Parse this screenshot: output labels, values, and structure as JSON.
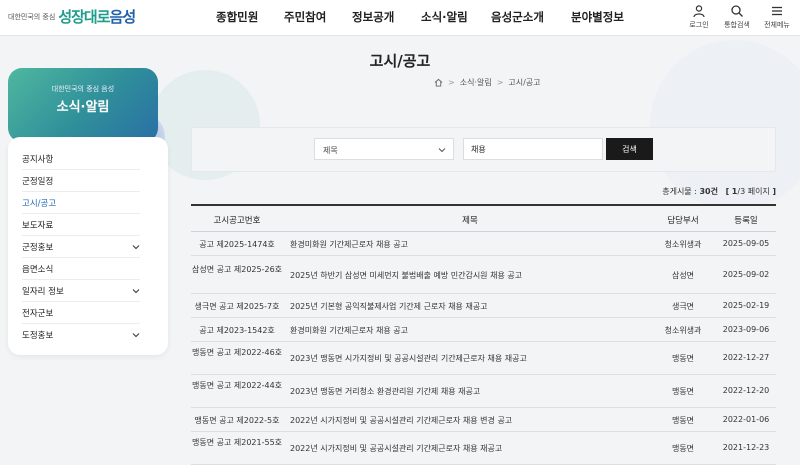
{
  "header": {
    "logo_small": "대한민국의 중심",
    "logo_main_a": "성장대로",
    "logo_main_b": "음성",
    "nav": [
      "종합민원",
      "주민참여",
      "정보공개",
      "소식·알림",
      "음성군소개",
      "분야별정보"
    ],
    "utils": [
      {
        "label": "로그인",
        "icon": "user-icon"
      },
      {
        "label": "통합검색",
        "icon": "search-icon"
      },
      {
        "label": "전체메뉴",
        "icon": "menu-icon"
      }
    ]
  },
  "page": {
    "title": "고시/공고",
    "breadcrumb": [
      "소식·알림",
      "고시/공고"
    ]
  },
  "side": {
    "sub": "대한민국의 중심 음성",
    "title": "소식·알림",
    "items": [
      {
        "label": "공지사항",
        "has_children": false,
        "active": false
      },
      {
        "label": "군정일정",
        "has_children": false,
        "active": false
      },
      {
        "label": "고시/공고",
        "has_children": false,
        "active": true
      },
      {
        "label": "보도자료",
        "has_children": false,
        "active": false
      },
      {
        "label": "군정홍보",
        "has_children": true,
        "active": false
      },
      {
        "label": "읍면소식",
        "has_children": false,
        "active": false
      },
      {
        "label": "일자리 정보",
        "has_children": true,
        "active": false
      },
      {
        "label": "전자군보",
        "has_children": false,
        "active": false
      },
      {
        "label": "도정홍보",
        "has_children": true,
        "active": false
      }
    ]
  },
  "search": {
    "field_selected": "제목",
    "query": "채용",
    "button": "검색"
  },
  "summary": {
    "total_label": "총게시물 : ",
    "total_count": "30건",
    "page_open": "[",
    "page_current": "1",
    "page_rest": "/3 페이지",
    "page_close": "]"
  },
  "table": {
    "headers": [
      "고시공고번호",
      "제목",
      "담당부서",
      "등록일"
    ],
    "rows": [
      {
        "num": "공고 제2025-1474호",
        "title": "환경미화원 기간제근로자 채용 공고",
        "dept": "청소위생과",
        "date": "2025-09-05"
      },
      {
        "num": "삼성면 공고 제2025-26호",
        "title": "2025년 하반기 삼성면 미세먼지 불법배출 예방 민간감시원 채용 공고",
        "dept": "삼성면",
        "date": "2025-09-02"
      },
      {
        "num": "생극면 공고 제2025-7호",
        "title": "2025년 기본형 공익직불제사업 기간제 근로자 채용 재공고",
        "dept": "생극면",
        "date": "2025-02-19"
      },
      {
        "num": "공고 제2023-1542호",
        "title": "환경미화원 기간제근로자 채용 공고",
        "dept": "청소위생과",
        "date": "2023-09-06"
      },
      {
        "num": "맹동면 공고 제2022-46호",
        "title": "2023년 맹동면 시가지정비 및 공공시설관리 기간제근로자 채용 재공고",
        "dept": "맹동면",
        "date": "2022-12-27"
      },
      {
        "num": "맹동면 공고 제2022-44호",
        "title": "2023년 맹동면 거리청소 환경관리원 기간제 채용 재공고",
        "dept": "맹동면",
        "date": "2022-12-20"
      },
      {
        "num": "맹동면 공고 제2022-5호",
        "title": "2022년 시가지정비 및 공공시설관리 기간제근로자 채용 변경 공고",
        "dept": "맹동면",
        "date": "2022-01-06"
      },
      {
        "num": "맹동면 공고 제2021-55호",
        "title": "2022년 시가지정비 및 공공시설관리 기간제근로자 채용 재공고",
        "dept": "맹동면",
        "date": "2021-12-23"
      }
    ]
  },
  "colors": {
    "accent": "#2767b8",
    "brand_teal": "#1d9e8a",
    "brand_blue": "#1e5fa8",
    "button": "#1a1a1a"
  }
}
